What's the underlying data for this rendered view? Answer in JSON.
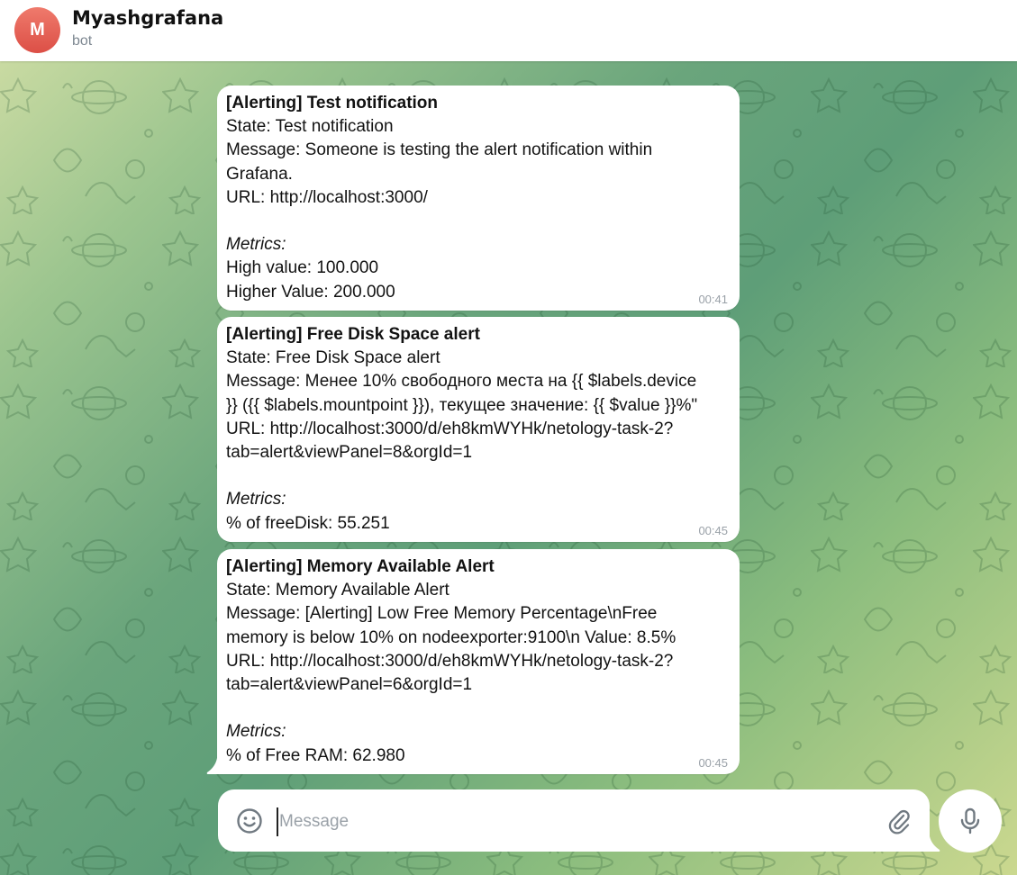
{
  "header": {
    "avatar_letter": "M",
    "title": "Myashgrafana",
    "subtitle": "bot"
  },
  "messages": [
    {
      "lines": [
        {
          "text": "[Alerting] Test notification",
          "style": "title"
        },
        {
          "text": "State: Test notification",
          "style": "normal"
        },
        {
          "text": "Message: Someone is testing the alert notification within",
          "style": "normal"
        },
        {
          "text": "Grafana.",
          "style": "normal"
        },
        {
          "text": "URL: http://localhost:3000/",
          "style": "normal"
        },
        {
          "text": "",
          "style": "normal"
        },
        {
          "text": "Metrics:",
          "style": "italic"
        },
        {
          "text": "High value: 100.000",
          "style": "normal"
        },
        {
          "text": "Higher Value: 200.000",
          "style": "normal"
        }
      ],
      "time": "00:41"
    },
    {
      "lines": [
        {
          "text": "[Alerting] Free Disk Space alert",
          "style": "title"
        },
        {
          "text": "State: Free Disk Space alert",
          "style": "normal"
        },
        {
          "text": "Message: Менее 10% свободного места на {{ $labels.device",
          "style": "normal"
        },
        {
          "text": "}} ({{ $labels.mountpoint }}), текущее значение: {{ $value }}%\"",
          "style": "normal"
        },
        {
          "text": "URL: http://localhost:3000/d/eh8kmWYHk/netology-task-2?",
          "style": "normal"
        },
        {
          "text": "tab=alert&viewPanel=8&orgId=1",
          "style": "normal"
        },
        {
          "text": "",
          "style": "normal"
        },
        {
          "text": "Metrics:",
          "style": "italic"
        },
        {
          "text": "% of freeDisk: 55.251",
          "style": "normal"
        }
      ],
      "time": "00:45"
    },
    {
      "lines": [
        {
          "text": "[Alerting] Memory Available Alert",
          "style": "title"
        },
        {
          "text": "State: Memory Available Alert",
          "style": "normal"
        },
        {
          "text": "Message: [Alerting] Low Free Memory Percentage\\nFree",
          "style": "normal"
        },
        {
          "text": "memory is below 10% on nodeexporter:9100\\n Value: 8.5%",
          "style": "normal"
        },
        {
          "text": "URL: http://localhost:3000/d/eh8kmWYHk/netology-task-2?",
          "style": "normal"
        },
        {
          "text": "tab=alert&viewPanel=6&orgId=1",
          "style": "normal"
        },
        {
          "text": "",
          "style": "normal"
        },
        {
          "text": "Metrics:",
          "style": "italic"
        },
        {
          "text": "% of Free RAM: 62.980",
          "style": "normal"
        }
      ],
      "time": "00:45"
    }
  ],
  "composer": {
    "placeholder": "Message",
    "value": ""
  },
  "icons": {
    "emoji": "smile-icon",
    "attach": "paperclip-icon",
    "mic": "microphone-icon"
  },
  "colors": {
    "avatar": "#dc4f46",
    "bubble": "#ffffff",
    "timestamp": "#9aa1a8",
    "placeholder": "#9aa1a8"
  }
}
